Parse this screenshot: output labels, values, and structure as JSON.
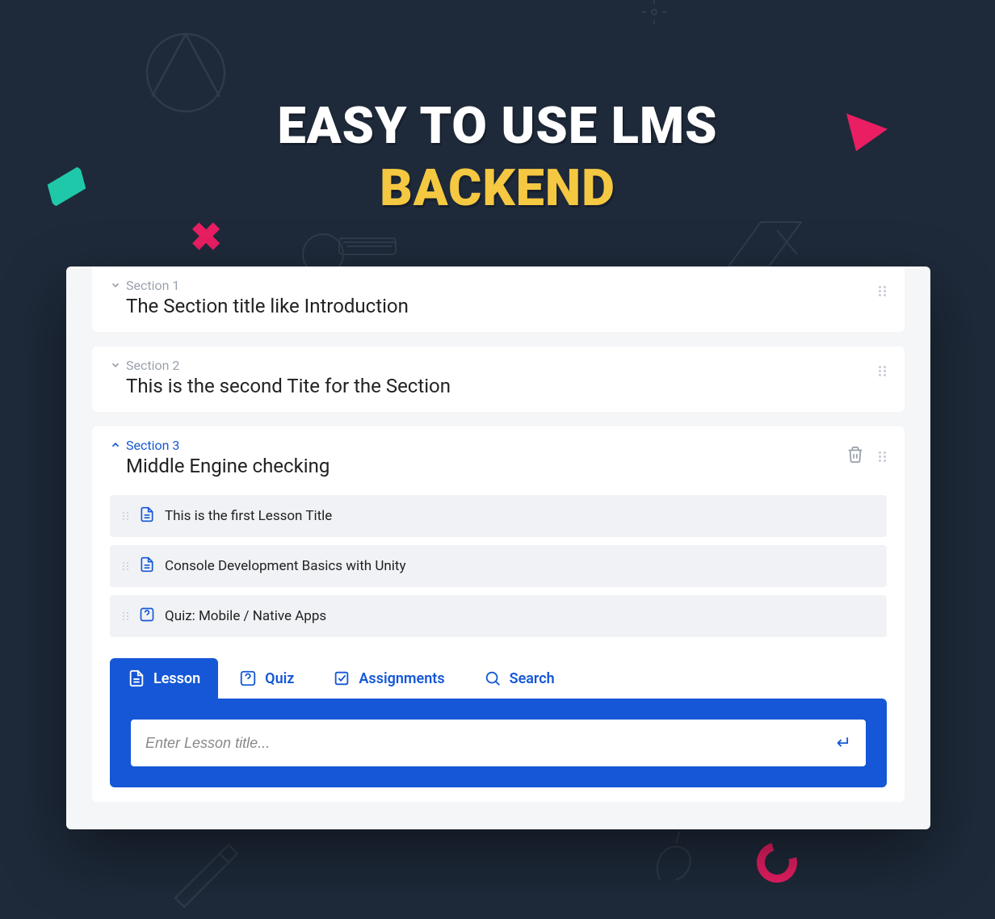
{
  "hero": {
    "line1": "EASY TO USE LMS",
    "line2": "BACKEND"
  },
  "sections": [
    {
      "label": "Section 1",
      "title": "The Section title like Introduction",
      "expanded": false
    },
    {
      "label": "Section 2",
      "title": "This is the second Tite for the Section",
      "expanded": false
    },
    {
      "label": "Section 3",
      "title": "Middle Engine checking",
      "expanded": true
    }
  ],
  "lessons": [
    {
      "icon": "document",
      "title": "This is the first Lesson Title"
    },
    {
      "icon": "document",
      "title": "Console Development Basics with Unity"
    },
    {
      "icon": "quiz",
      "title": "Quiz: Mobile / Native Apps"
    }
  ],
  "tabs": {
    "lesson": "Lesson",
    "quiz": "Quiz",
    "assignments": "Assignments",
    "search": "Search"
  },
  "input": {
    "placeholder": "Enter Lesson title..."
  }
}
